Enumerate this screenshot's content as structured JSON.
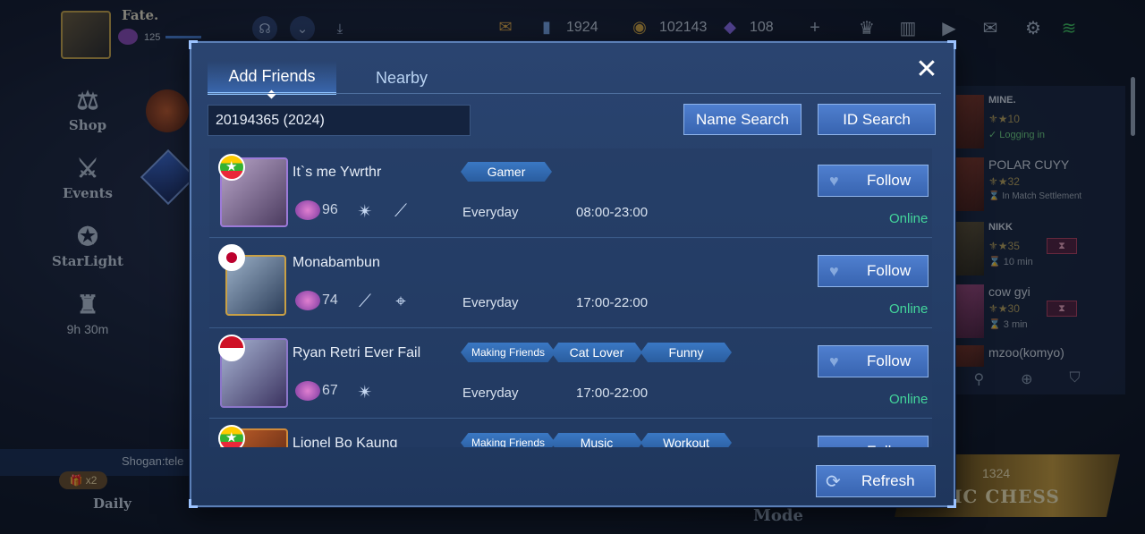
{
  "player": {
    "name": "Fate.",
    "level": "125"
  },
  "currency": {
    "tickets": "1924",
    "coins": "102143",
    "diamonds": "108"
  },
  "left_nav": {
    "shop": "Shop",
    "events": "Events",
    "starlight": "StarLight",
    "timer": "9h 30m"
  },
  "ticker": "Shogan:tele",
  "gift_count": "x2",
  "daily": "Daily",
  "mode": "Mode",
  "magic_chess": {
    "count": "1324",
    "label": "GIC CHESS"
  },
  "friends_panel": [
    {
      "name": "MINE.",
      "rank": "10",
      "status": "Logging in",
      "status_color": "green"
    },
    {
      "name": "POLAR CUYY",
      "rank": "32",
      "status": "In Match Settlement",
      "status_color": "grey"
    },
    {
      "name": "NIKK",
      "rank": "35",
      "status": "10 min",
      "status_color": "grey"
    },
    {
      "name": "cow gyi",
      "rank": "30",
      "status": "3 min",
      "status_color": "grey"
    },
    {
      "name": "mzoo(komyo)",
      "rank": "",
      "status": "",
      "status_color": "grey"
    }
  ],
  "dialog": {
    "tabs": [
      {
        "label": "Add Friends",
        "active": true
      },
      {
        "label": "Nearby",
        "active": false
      }
    ],
    "search_value": "20194365 (2024)",
    "name_search": "Name Search",
    "id_search": "ID Search",
    "refresh": "Refresh",
    "follow": "Follow",
    "results": [
      {
        "name": "It`s me Ywrthr",
        "flag": "mm",
        "rank": "96",
        "tags": [
          "Gamer"
        ],
        "days": "Everyday",
        "hours": "08:00-23:00",
        "status": "Online",
        "roles": [
          "shuriken-icon",
          "spear-icon"
        ]
      },
      {
        "name": "Monabambun",
        "flag": "jp",
        "rank": "74",
        "tags": [],
        "days": "Everyday",
        "hours": "17:00-22:00",
        "status": "Online",
        "roles": [
          "spear-icon",
          "crosshair-icon"
        ]
      },
      {
        "name": "Ryan Retri Ever Fail",
        "flag": "id",
        "rank": "67",
        "tags": [
          "Making Friends",
          "Cat Lover",
          "Funny"
        ],
        "days": "Everyday",
        "hours": "17:00-22:00",
        "status": "Online",
        "roles": [
          "shuriken-icon"
        ]
      },
      {
        "name": "Lionel Bo Kaung",
        "flag": "mm",
        "rank": "",
        "tags": [
          "Making Friends",
          "Music",
          "Workout"
        ],
        "days": "",
        "hours": "",
        "status": "",
        "roles": []
      }
    ]
  },
  "colors": {
    "online": "#43d69b",
    "accent": "#3864b0",
    "panel": "#243d66"
  }
}
